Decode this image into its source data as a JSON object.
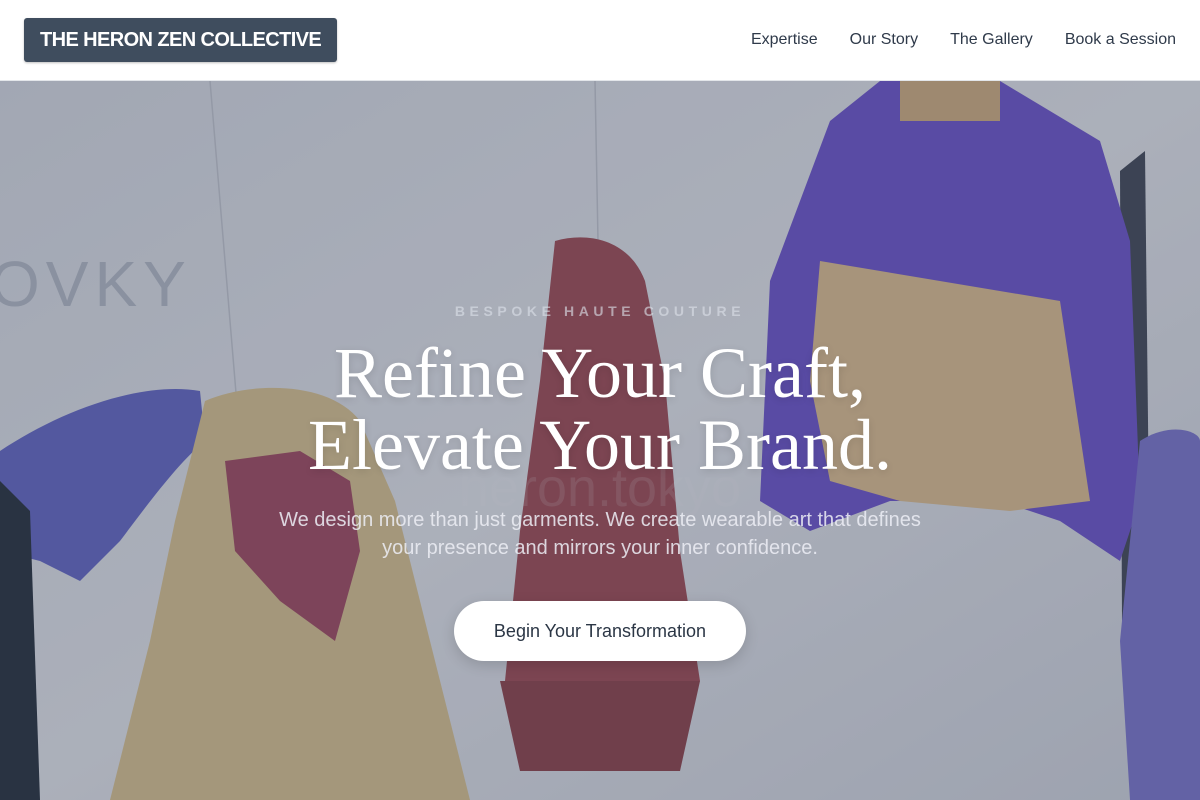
{
  "header": {
    "logo_text": "THE HERON ZEN COLLECTIVE",
    "nav": [
      {
        "label": "Expertise"
      },
      {
        "label": "Our Story"
      },
      {
        "label": "The Gallery"
      },
      {
        "label": "Book a Session"
      }
    ]
  },
  "hero": {
    "eyebrow": "BESPOKE HAUTE COUTURE",
    "headline_line1": "Refine Your Craft,",
    "headline_line2": "Elevate Your Brand.",
    "subtext": "We design more than just garments. We create wearable art that defines your presence and mirrors your inner confidence.",
    "cta_label": "Begin Your Transformation",
    "background_text": "OVKY",
    "background_sign": "heron.tokyo"
  },
  "colors": {
    "logo_bg": "#3f4d5e",
    "nav_text": "#2f3a4a",
    "overlay": "#3e485c",
    "cta_bg": "#ffffff",
    "cta_text": "#2b3645"
  }
}
